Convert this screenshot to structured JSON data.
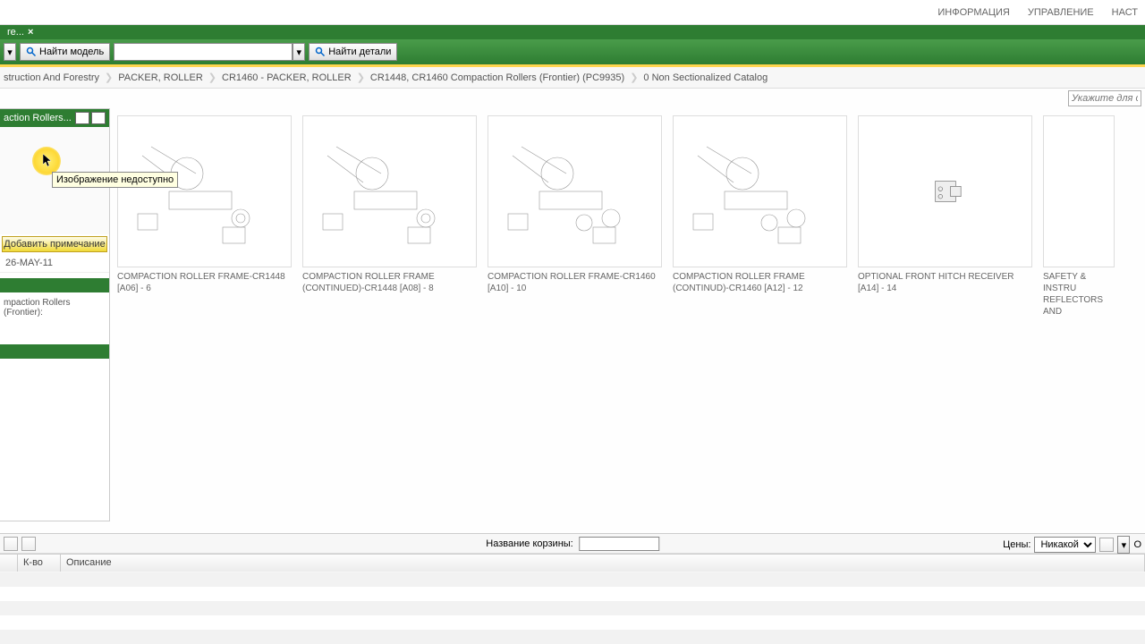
{
  "top_menu": {
    "info": "ИНФОРМАЦИЯ",
    "manage": "УПРАВЛЕНИЕ",
    "settings": "НАСТ"
  },
  "tab": {
    "label": "re..."
  },
  "toolbar": {
    "find_model": "Найти модель",
    "find_parts": "Найти детали",
    "dropdown_value": ""
  },
  "breadcrumb": {
    "c0": "struction And Forestry",
    "c1": "PACKER, ROLLER",
    "c2": "CR1460 - PACKER, ROLLER",
    "c3": "CR1448, CR1460 Compaction Rollers (Frontier) (PC9935)",
    "c4": "0 Non Sectionalized Catalog"
  },
  "filter": {
    "placeholder": "Укажите для огр"
  },
  "left_panel": {
    "title": "action Rollers...",
    "tooltip": "Изображение недоступно",
    "add_note": "Добавить примечание",
    "date": "26-MAY-11",
    "section": "mpaction Rollers (Frontier):"
  },
  "cards": [
    {
      "label": "COMPACTION ROLLER FRAME-CR1448 [A06] - 6"
    },
    {
      "label": "COMPACTION ROLLER FRAME (CONTINUED)-CR1448 [A08] - 8"
    },
    {
      "label": "COMPACTION ROLLER FRAME-CR1460 [A10] - 10"
    },
    {
      "label": "COMPACTION ROLLER FRAME (CONTINUD)-CR1460 [A12] - 12"
    },
    {
      "label": "OPTIONAL FRONT HITCH RECEIVER [A14] - 14"
    },
    {
      "label": "SAFETY & INSTRU REFLECTORS AND"
    }
  ],
  "bottom": {
    "basket_label": "Название корзины:",
    "basket_value": "",
    "prices_label": "Цены:",
    "price_option": "Никакой",
    "col_qty": "К-во",
    "col_desc": "Описание",
    "col_o": "О"
  }
}
